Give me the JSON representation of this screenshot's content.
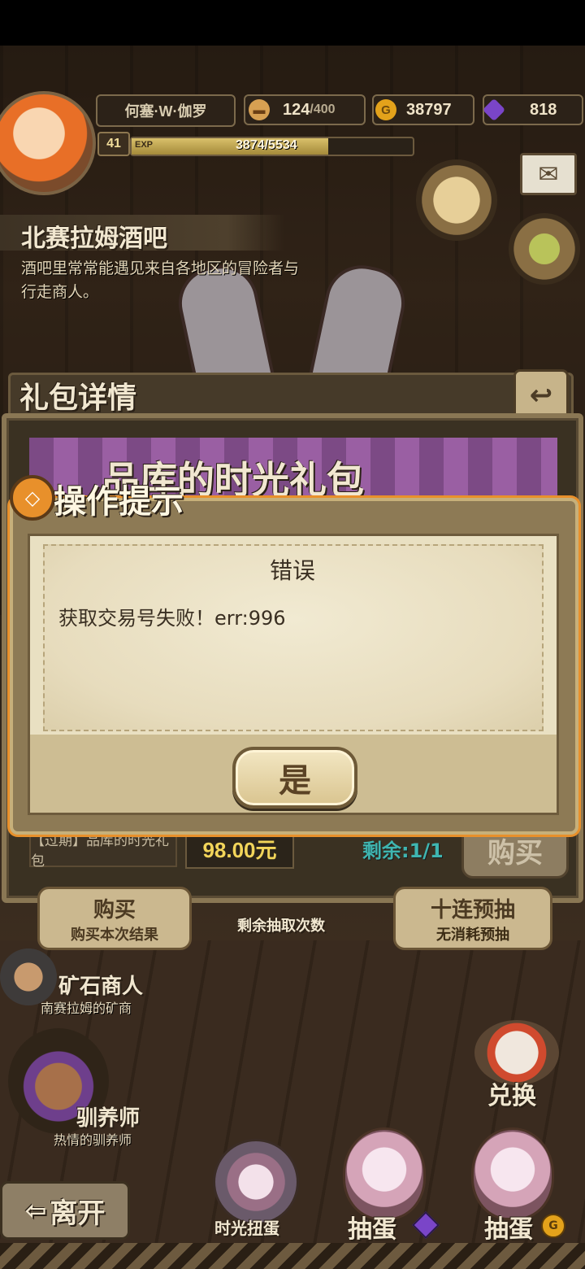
{
  "hud": {
    "player_name": "何塞·W·伽罗",
    "level": "41",
    "exp_label": "EXP",
    "exp_text": "3874/5534",
    "exp_fraction": 0.7,
    "stamina_value": "124",
    "stamina_max": "/400",
    "gold": "38797",
    "gems": "818",
    "gold_icon_letter": "G"
  },
  "location": {
    "name": "北赛拉姆酒吧",
    "description": "酒吧里常常能遇见来自各地区的冒险者与行走商人。"
  },
  "gift_panel": {
    "header": "礼包详情",
    "banner_title": "品库的时光礼包",
    "tag": "【过期】品库的时光礼包",
    "price": "98.00元",
    "remaining": "剩余:1/1",
    "buy_label": "购买"
  },
  "dialog": {
    "tab_title": "操作提示",
    "title": "错误",
    "message": "获取交易号失败！err:996",
    "confirm_label": "是"
  },
  "bottom": {
    "buy_result_top": "购买",
    "buy_result_sub": "购买本次结果",
    "draws_left": "剩余抽取次数",
    "ten_draw_top": "十连预抽",
    "ten_draw_sub": "无消耗预抽",
    "npc1_name": "矿石商人",
    "npc1_desc": "南赛拉姆的矿商",
    "npc2_name": "驯养师",
    "npc2_desc": "热情的驯养师",
    "exchange_label": "兑换",
    "leave_label": "离开",
    "time_draw_label": "时光扭蛋",
    "draw_label_1": "抽蛋",
    "draw_label_2": "抽蛋"
  },
  "colors": {
    "accent_orange": "#e8902b",
    "remaining_teal": "#3fb5b0",
    "price_gold": "#f2d55a",
    "gem_purple": "#7a45c8",
    "gold_coin": "#e3a21b"
  }
}
